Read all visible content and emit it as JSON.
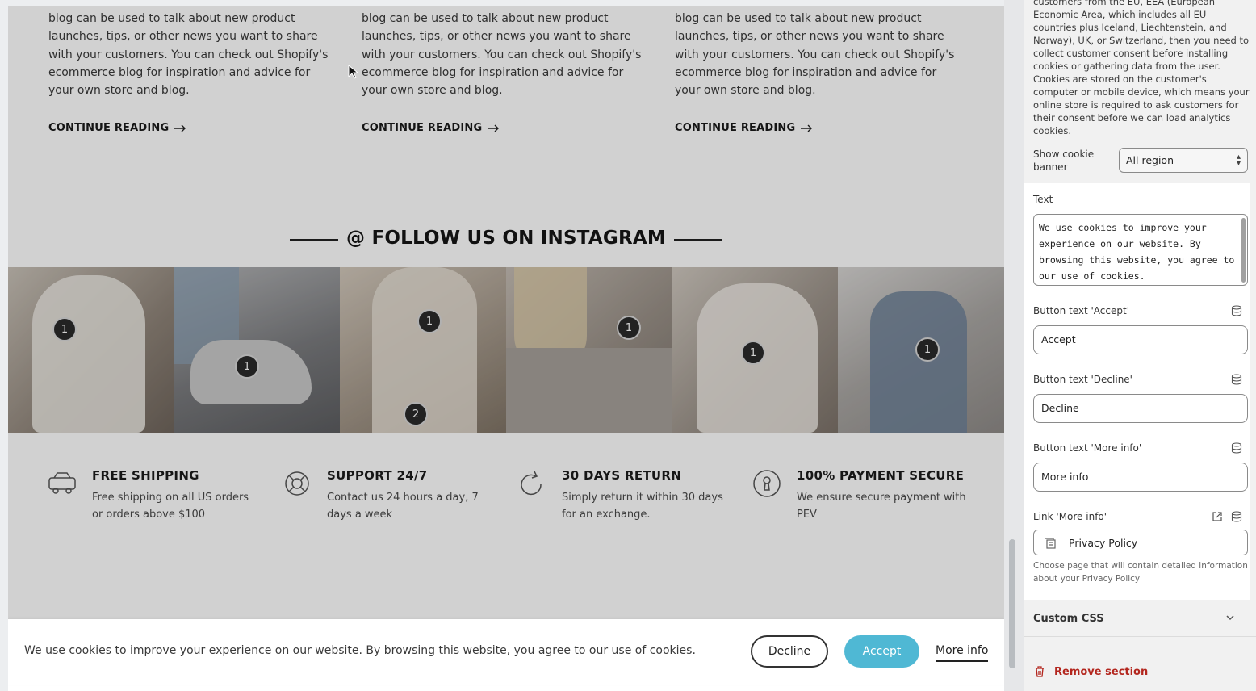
{
  "blog": {
    "excerpt": "blog can be used to talk about new product launches, tips, or other news you want to share with your customers. You can check out Shopify's ecommerce blog for inspiration and advice for your own store and blog.",
    "continue_label": "CONTINUE READING"
  },
  "instagram": {
    "heading": "@ FOLLOW US ON INSTAGRAM",
    "badges": [
      "1",
      "1",
      "1",
      "2",
      "1",
      "1",
      "1"
    ]
  },
  "features": [
    {
      "title": "FREE SHIPPING",
      "desc": "Free shipping on all US orders or orders above $100",
      "icon": "truck-icon"
    },
    {
      "title": "SUPPORT 24/7",
      "desc": "Contact us 24 hours a day, 7 days a week",
      "icon": "lifebuoy-icon"
    },
    {
      "title": "30 DAYS RETURN",
      "desc": "Simply return it within 30 days for an exchange.",
      "icon": "return-icon"
    },
    {
      "title": "100% PAYMENT SECURE",
      "desc": "We ensure secure payment with PEV",
      "icon": "lock-icon"
    }
  ],
  "cookie_banner": {
    "text": "We use cookies to improve your experience on our website. By browsing this website, you agree to our use of cookies.",
    "decline": "Decline",
    "accept": "Accept",
    "more_info": "More info",
    "accept_color": "#4fb8d4"
  },
  "panel": {
    "consent_description": "customers from the EU, EEA (European Economic Area, which includes all EU countries plus Iceland, Liechtenstein, and Norway), UK, or Switzerland, then you need to collect customer consent before installing cookies or gathering data from the user. Cookies are stored on the customer's computer or mobile device, which means your online store is required to ask customers for their consent before we can load analytics cookies.",
    "show_banner_label": "Show cookie banner",
    "region_value": "All region",
    "text_label": "Text",
    "text_value": "We use cookies to improve your experience on our website. By browsing this website, you agree to our use of cookies.",
    "accept_label": "Button text 'Accept'",
    "accept_value": "Accept",
    "decline_label": "Button text 'Decline'",
    "decline_value": "Decline",
    "more_label": "Button text 'More info'",
    "more_value": "More info",
    "link_label": "Link 'More info'",
    "link_value": "Privacy Policy",
    "link_help": "Choose page that will contain detailed information about your Privacy Policy",
    "custom_css": "Custom CSS",
    "remove_section": "Remove section",
    "remove_color": "#b3261e"
  }
}
